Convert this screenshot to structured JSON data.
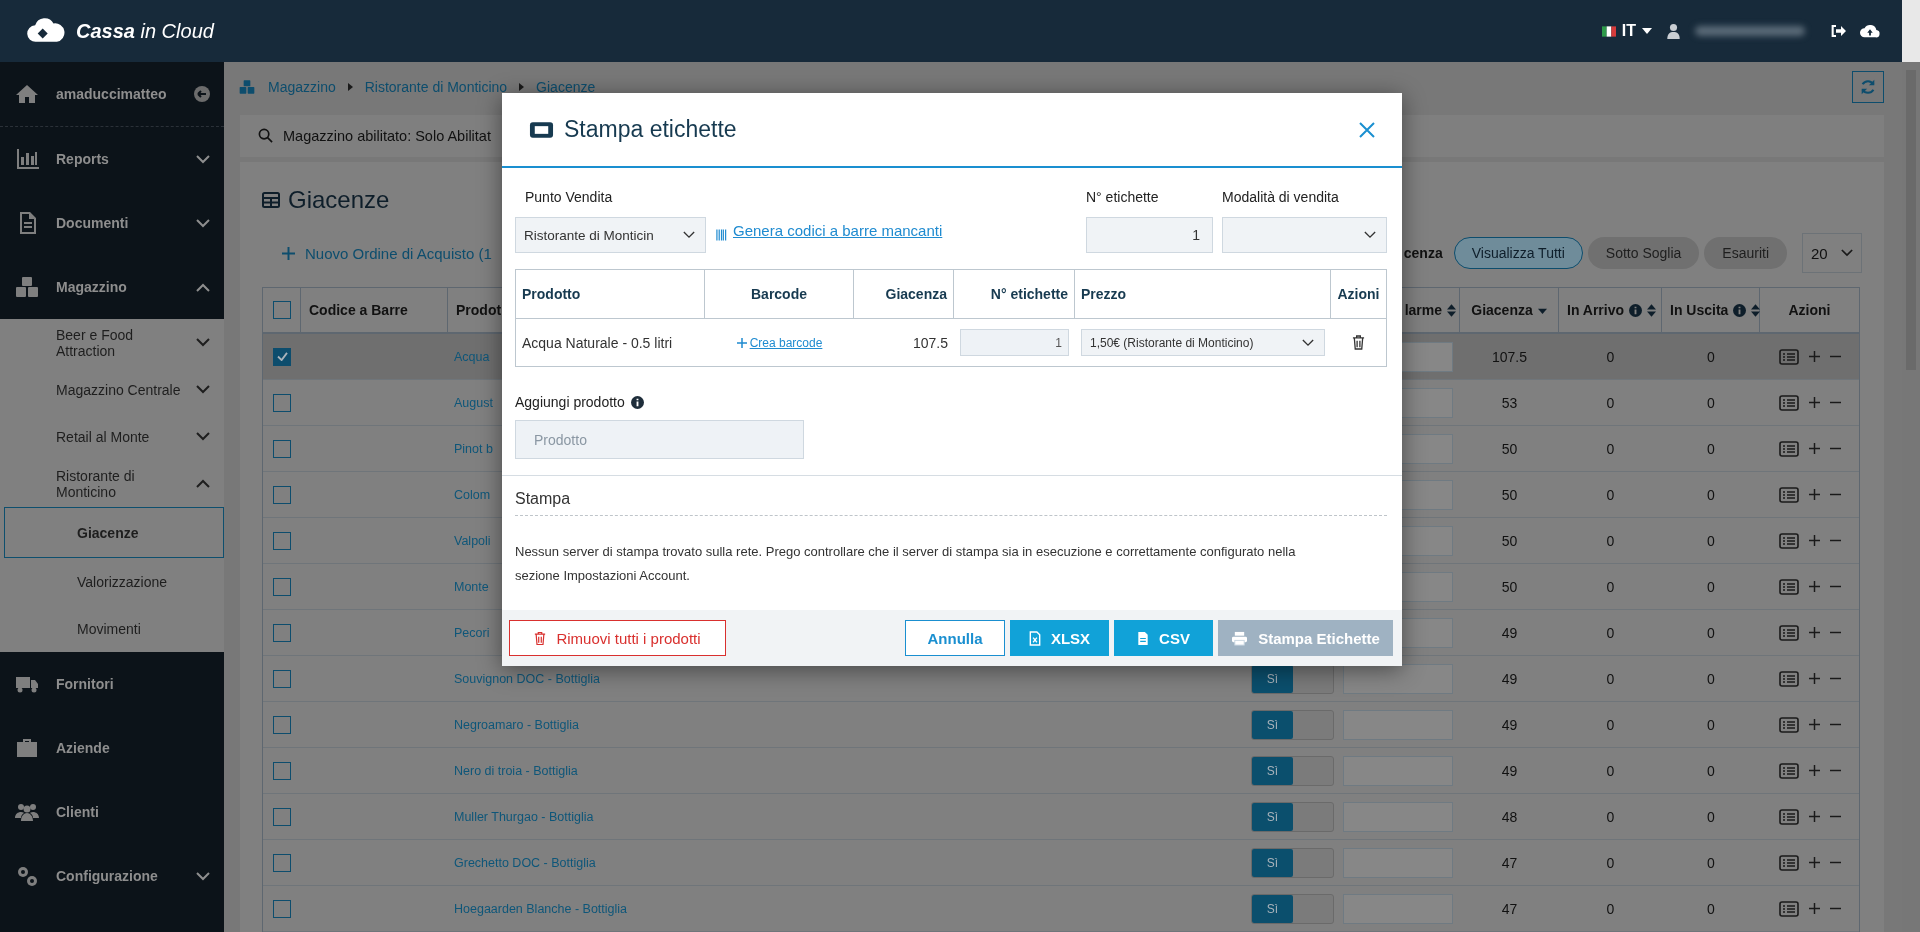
{
  "topbar": {
    "brand": "**Cassa** in Cloud",
    "language": "IT"
  },
  "sidebar": {
    "user": "amaduccimatteo",
    "items": [
      {
        "label": "Reports",
        "expanded": false
      },
      {
        "label": "Documenti",
        "expanded": false
      },
      {
        "label": "Magazzino",
        "expanded": true,
        "children": [
          {
            "label": "Beer e Food Attraction",
            "expanded": false
          },
          {
            "label": "Magazzino Centrale",
            "expanded": false
          },
          {
            "label": "Retail al Monte",
            "expanded": false
          },
          {
            "label": "Ristorante di Monticino",
            "expanded": true,
            "children": [
              {
                "label": "Giacenze",
                "selected": true
              },
              {
                "label": "Valorizzazione",
                "selected": false
              },
              {
                "label": "Movimenti",
                "selected": false
              }
            ]
          }
        ]
      },
      {
        "label": "Fornitori"
      },
      {
        "label": "Aziende"
      },
      {
        "label": "Clienti"
      },
      {
        "label": "Configurazione",
        "expanded": false
      }
    ]
  },
  "breadcrumb": [
    "Magazzino",
    "Ristorante di Monticino",
    "Giacenze"
  ],
  "search": {
    "text": "Magazzino abilitato: Solo Abilitat"
  },
  "stock": {
    "title": "Giacenze",
    "new_order": "Nuovo Ordine di Acquisto (1",
    "filter_label": "cenza",
    "filters": [
      {
        "label": "Visualizza Tutti",
        "selected": true
      },
      {
        "label": "Sotto Soglia",
        "selected": false
      },
      {
        "label": "Esauriti",
        "selected": false
      }
    ],
    "page_size": "20",
    "table": {
      "all_checked": false,
      "columns": [
        {
          "label": "Codice a Barre"
        },
        {
          "label": "Prodot"
        },
        {
          "label": "larme",
          "sortable": true,
          "sorted": false
        },
        {
          "label": "Giacenza",
          "sortable": true,
          "sorted": true
        },
        {
          "label": "In Arrivo",
          "info": true,
          "sortable": true,
          "sorted": false
        },
        {
          "label": "In Uscita",
          "info": true,
          "sortable": true,
          "sorted": false
        },
        {
          "label": "Azioni"
        }
      ],
      "rows": [
        {
          "checked": true,
          "product": "Acqua",
          "giacenza": "107.5",
          "in_arrivo": "0",
          "in_uscita": "0"
        },
        {
          "checked": false,
          "product": "August",
          "giacenza": "53",
          "in_arrivo": "0",
          "in_uscita": "0"
        },
        {
          "checked": false,
          "product": "Pinot b",
          "giacenza": "50",
          "in_arrivo": "0",
          "in_uscita": "0"
        },
        {
          "checked": false,
          "product": "Colom",
          "giacenza": "50",
          "in_arrivo": "0",
          "in_uscita": "0"
        },
        {
          "checked": false,
          "product": "Valpoli",
          "giacenza": "50",
          "in_arrivo": "0",
          "in_uscita": "0"
        },
        {
          "checked": false,
          "product": "Monte",
          "giacenza": "50",
          "in_arrivo": "0",
          "in_uscita": "0"
        },
        {
          "checked": false,
          "product": "Pecori",
          "giacenza": "49",
          "in_arrivo": "0",
          "in_uscita": "0"
        },
        {
          "checked": false,
          "product": "Souvignon DOC - Bottiglia",
          "toggle": {
            "label": "Sì",
            "on": true
          },
          "giacenza": "49",
          "in_arrivo": "0",
          "in_uscita": "0"
        },
        {
          "checked": false,
          "product": "Negroamaro - Bottiglia",
          "toggle": {
            "label": "Sì",
            "on": true
          },
          "giacenza": "49",
          "in_arrivo": "0",
          "in_uscita": "0"
        },
        {
          "checked": false,
          "product": "Nero di troia - Bottiglia",
          "toggle": {
            "label": "Sì",
            "on": true
          },
          "giacenza": "49",
          "in_arrivo": "0",
          "in_uscita": "0"
        },
        {
          "checked": false,
          "product": "Muller Thurgao - Bottiglia",
          "toggle": {
            "label": "Sì",
            "on": true
          },
          "giacenza": "48",
          "in_arrivo": "0",
          "in_uscita": "0"
        },
        {
          "checked": false,
          "product": "Grechetto DOC - Bottiglia",
          "toggle": {
            "label": "Sì",
            "on": true
          },
          "giacenza": "47",
          "in_arrivo": "0",
          "in_uscita": "0"
        },
        {
          "checked": false,
          "product": "Hoegaarden Blanche - Bottiglia",
          "toggle": {
            "label": "Sì",
            "on": true
          },
          "giacenza": "47",
          "in_arrivo": "0",
          "in_uscita": "0"
        }
      ]
    }
  },
  "modal": {
    "title": "Stampa etichette",
    "store": {
      "label": "Punto Vendita",
      "value": "Ristorante di Monticin"
    },
    "generate_link": "Genera codici a barre mancanti",
    "label_count": {
      "label": "N° etichette",
      "value": "1"
    },
    "sale_mode": {
      "label": "Modalità di vendita"
    },
    "table": {
      "columns": [
        "Prodotto",
        "Barcode",
        "Giacenza",
        "N° etichette",
        "Prezzo",
        "Azioni"
      ],
      "rows": [
        {
          "product": "Acqua Naturale - 0.5 litri",
          "barcode_link": "Crea barcode",
          "giacenza": "107.5",
          "labels": "1",
          "price": "1,50€ (Ristorante di Monticino)"
        }
      ]
    },
    "add_product": {
      "label": "Aggiungi prodotto",
      "placeholder": "Prodotto"
    },
    "print": {
      "title": "Stampa",
      "message": "Nessun server di stampa trovato sulla rete. Prego controllare che il server di stampa sia in esecuzione e correttamente configurato nella sezione Impostazioni Account."
    },
    "buttons": [
      {
        "label": "Rimuovi tutti i prodotti",
        "kind": "danger",
        "disabled": false
      },
      {
        "label": "Annulla",
        "kind": "outline",
        "disabled": false
      },
      {
        "label": "XLSX",
        "kind": "xlsx",
        "disabled": false
      },
      {
        "label": "CSV",
        "kind": "csv",
        "disabled": false
      },
      {
        "label": "Stampa Etichette",
        "kind": "print",
        "disabled": true
      }
    ]
  }
}
